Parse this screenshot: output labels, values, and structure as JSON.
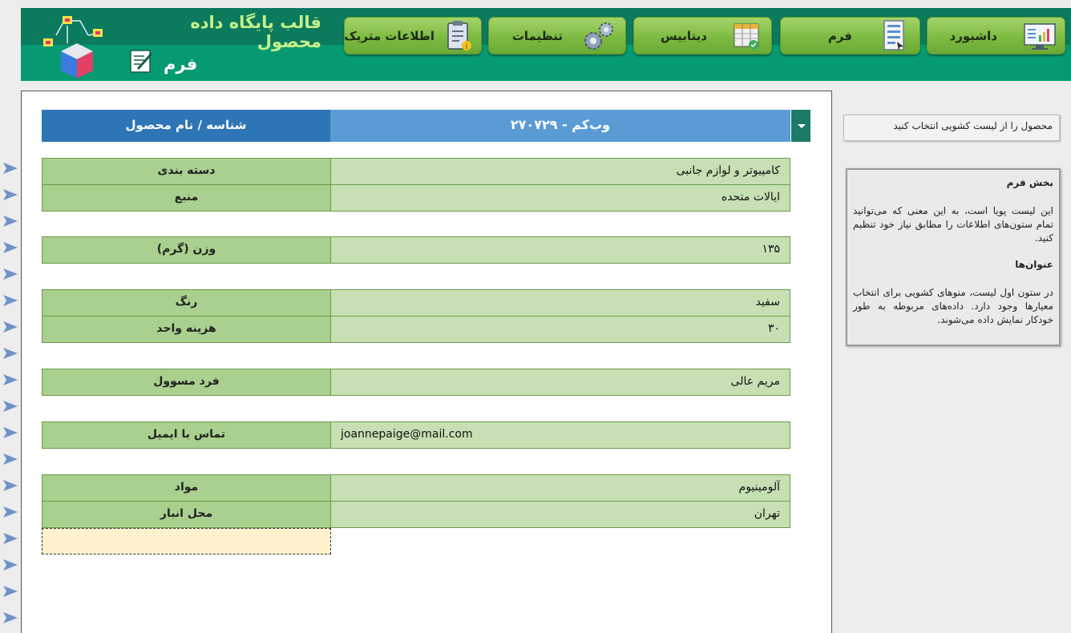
{
  "header": {
    "app_title": "قالب پایگاه داده محصول",
    "page_title": "فرم",
    "nav": [
      {
        "label": "داشبورد",
        "icon": "dashboard-icon"
      },
      {
        "label": "فرم",
        "icon": "form-icon"
      },
      {
        "label": "دیتابیس",
        "icon": "database-icon"
      },
      {
        "label": "تنظیمات",
        "icon": "gears-icon"
      },
      {
        "label": "اطلاعات متریک",
        "icon": "clipboard-info-icon"
      }
    ]
  },
  "picker": {
    "label": "شناسه / نام محصول",
    "value": "وب‌کم - ۲۷۰۷۲۹"
  },
  "fields": [
    {
      "label": "دسته بندی",
      "value": "کامپیوتر و لوازم جانبی"
    },
    {
      "label": "منبع",
      "value": "ایالات متحده"
    },
    {
      "label": "وزن (گرم)",
      "value": "۱۳۵"
    },
    {
      "label": "رنگ",
      "value": "سفید"
    },
    {
      "label": "هزینه واحد",
      "value": "۳۰"
    },
    {
      "label": "فرد مسوول",
      "value": "مریم عالی"
    },
    {
      "label": "تماس با ایمیل",
      "value": "joannepaige@mail.com"
    },
    {
      "label": "مواد",
      "value": "آلومینیوم"
    },
    {
      "label": "محل انبار",
      "value": "تهران"
    }
  ],
  "hint": "محصول را از لیست کشویی انتخاب کنید",
  "info": {
    "section1_title": "بخش فرم",
    "section1_text": "این لیست پویا است، به این معنی که می‌توانید تمام ستون‌های اطلاعات را مطابق نیاز خود تنظیم کنید.",
    "section2_title": "عنوان‌ها",
    "section2_text": "در ستون اول لیست، منوهای کشویی برای انتخاب معیارها وجود دارد. داده‌های مربوطه به طور خودکار نمایش داده می‌شوند."
  },
  "colors": {
    "header_dark": "#0b7a5d",
    "header_green": "#069a72",
    "title_accent": "#c7f08a",
    "picker_label": "#2e75b6",
    "picker_value": "#5b9bd5",
    "row_fill": "#c6e0b4",
    "row_label": "#a9d08e",
    "empty_cell": "#fff2cc"
  }
}
